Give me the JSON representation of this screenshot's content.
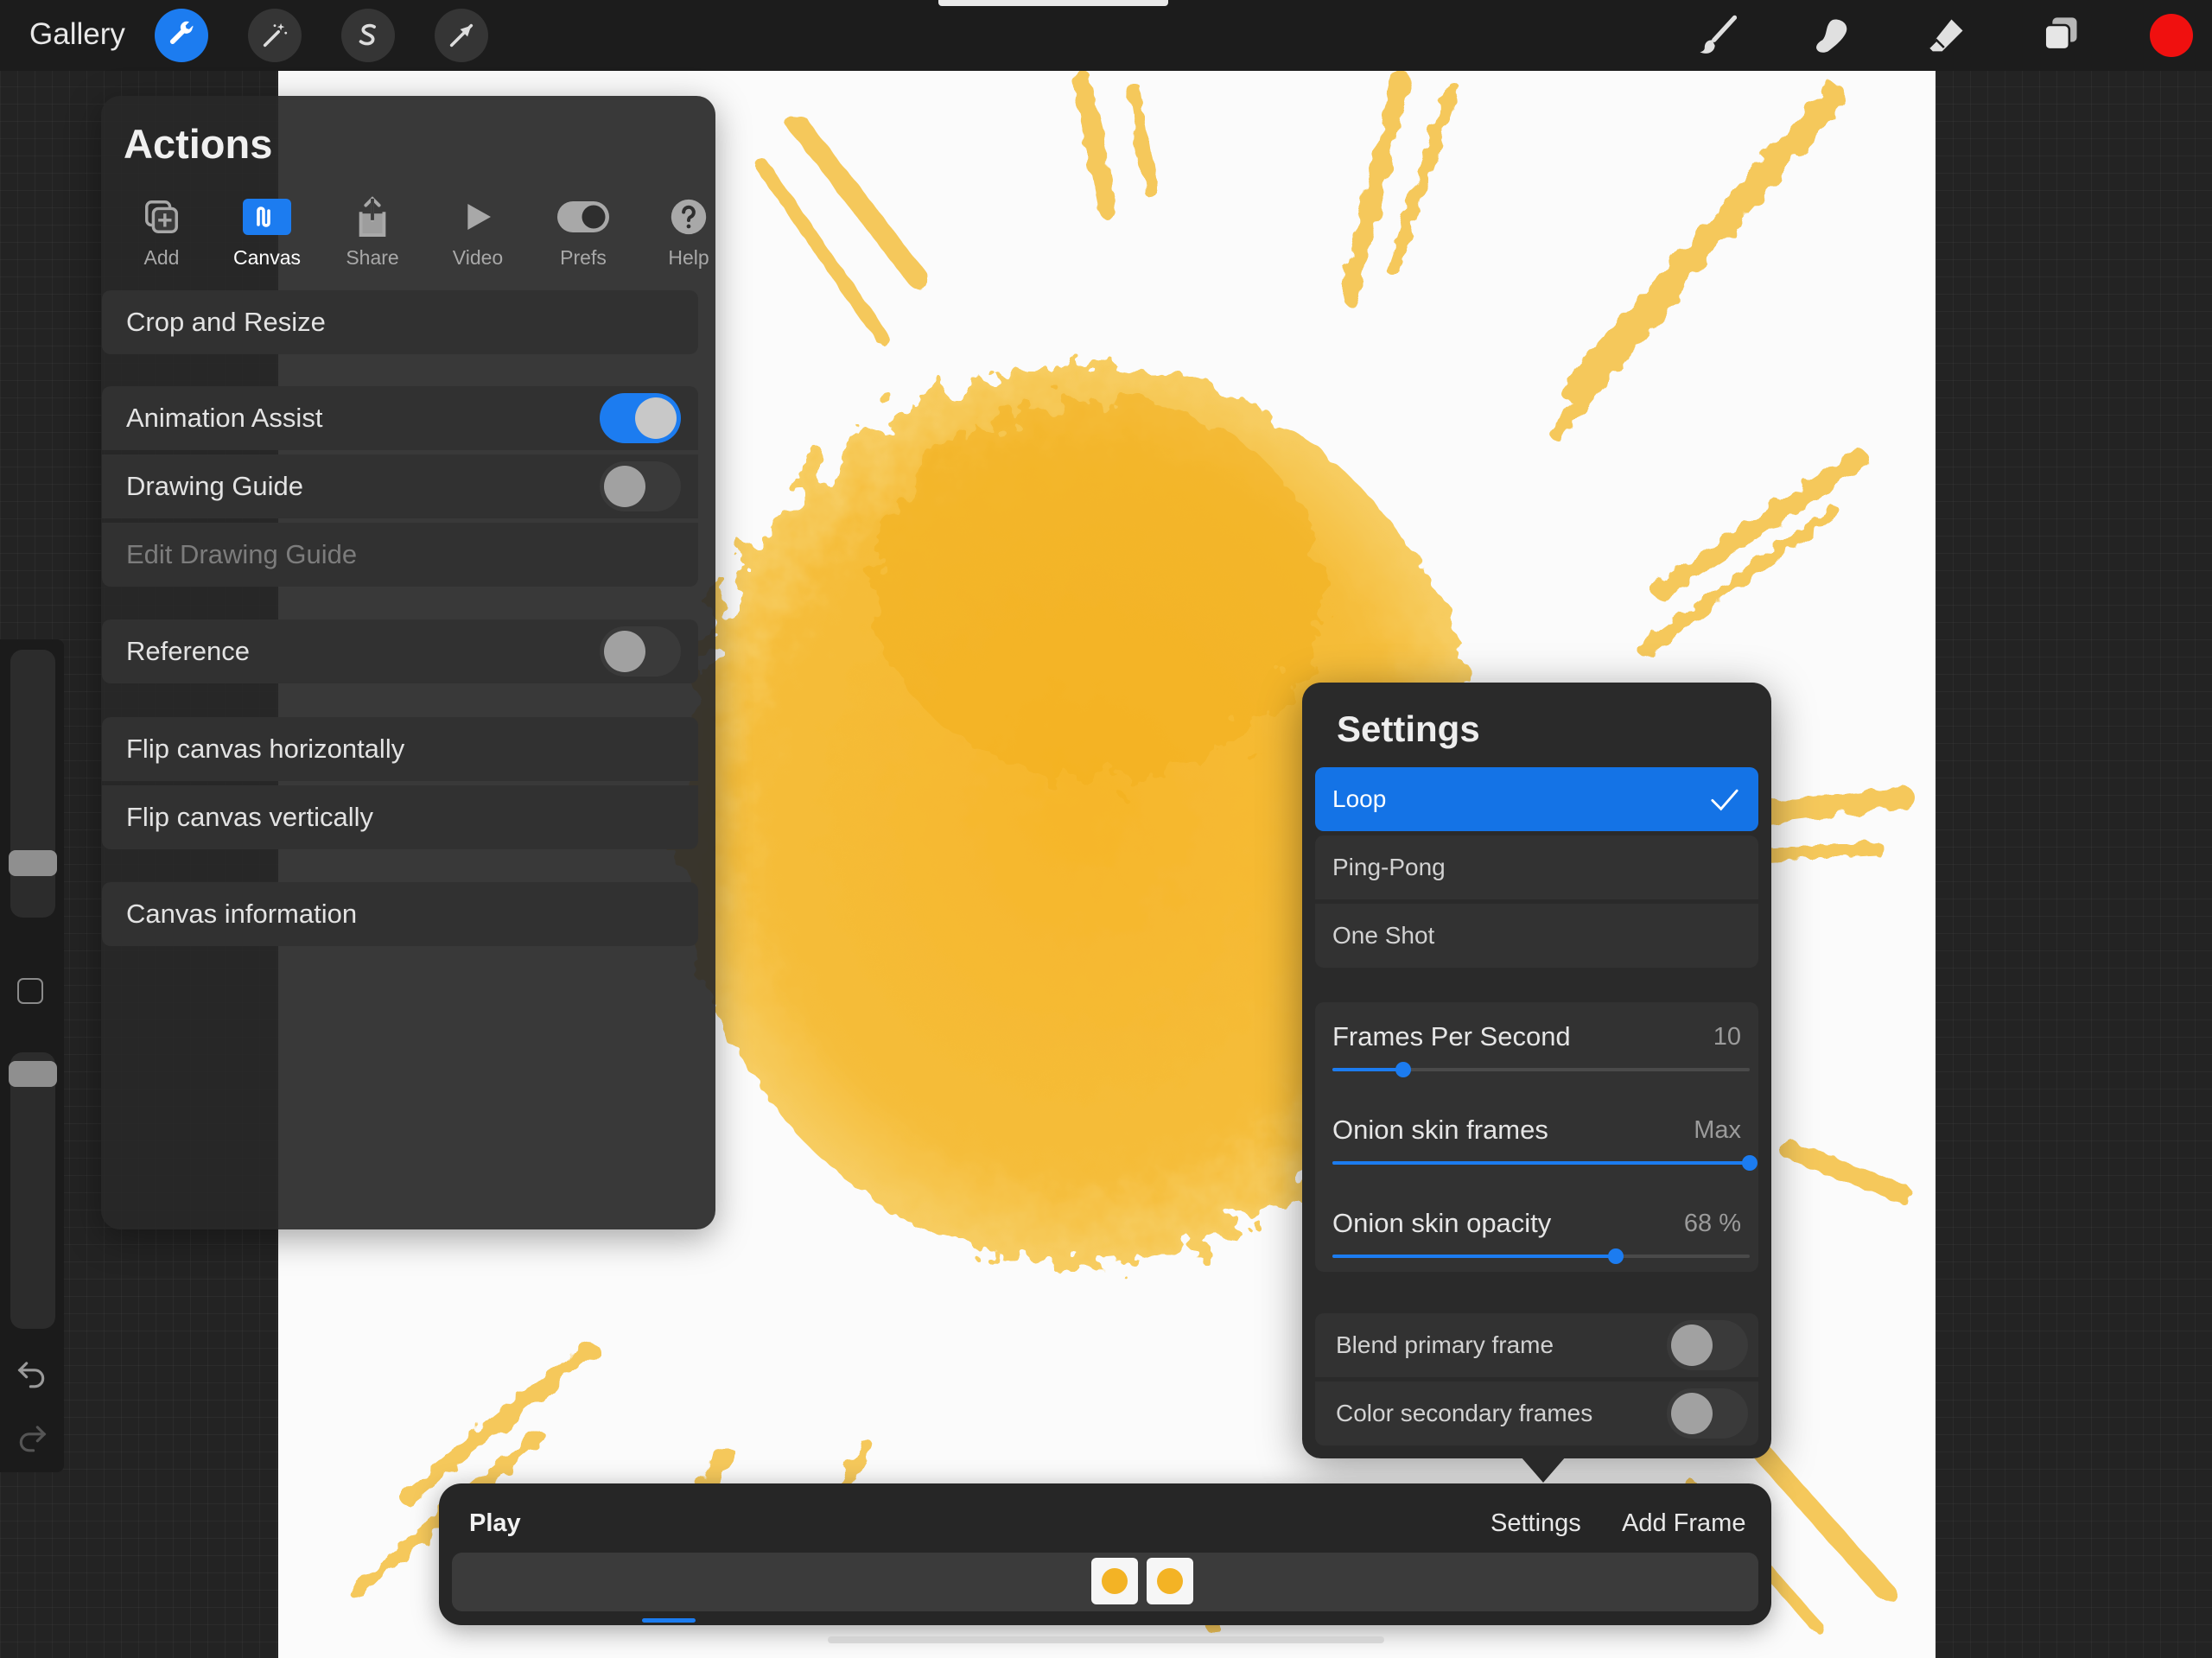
{
  "topbar": {
    "gallery_label": "Gallery",
    "left_tools": [
      "wrench-icon",
      "magic-wand-icon",
      "selection-s-icon",
      "transform-arrow-icon"
    ],
    "right_tools": [
      "brush-icon",
      "smudge-icon",
      "eraser-icon",
      "layers-icon"
    ],
    "current_color": "#f0100f"
  },
  "actions": {
    "title": "Actions",
    "tabs": [
      {
        "label": "Add",
        "icon": "add-icon"
      },
      {
        "label": "Canvas",
        "icon": "canvas-icon",
        "active": true
      },
      {
        "label": "Share",
        "icon": "share-icon"
      },
      {
        "label": "Video",
        "icon": "video-play-icon"
      },
      {
        "label": "Prefs",
        "icon": "prefs-toggle-icon"
      },
      {
        "label": "Help",
        "icon": "help-icon"
      }
    ],
    "items": {
      "crop_resize": "Crop and Resize",
      "animation_assist": "Animation Assist",
      "drawing_guide": "Drawing Guide",
      "edit_drawing_guide": "Edit Drawing Guide",
      "reference": "Reference",
      "flip_h": "Flip canvas horizontally",
      "flip_v": "Flip canvas vertically",
      "canvas_info": "Canvas information"
    },
    "toggles": {
      "animation_assist": true,
      "drawing_guide": false,
      "reference": false
    }
  },
  "settings": {
    "title": "Settings",
    "modes": [
      "Loop",
      "Ping-Pong",
      "One Shot"
    ],
    "selected_mode": "Loop",
    "fps": {
      "label": "Frames Per Second",
      "value": "10",
      "fraction": 0.17
    },
    "onion_frames": {
      "label": "Onion skin frames",
      "value": "Max",
      "fraction": 1.0
    },
    "onion_opacity": {
      "label": "Onion skin opacity",
      "value": "68 %",
      "fraction": 0.68
    },
    "blend_primary": {
      "label": "Blend primary frame",
      "on": false
    },
    "color_secondary": {
      "label": "Color secondary frames",
      "on": false
    }
  },
  "timeline": {
    "play_label": "Play",
    "settings_label": "Settings",
    "add_frame_label": "Add Frame",
    "frame_count": 2,
    "accent": "#1c7cf0"
  },
  "colors": {
    "accent": "#1c7cf0",
    "sun": "#f3b325"
  }
}
